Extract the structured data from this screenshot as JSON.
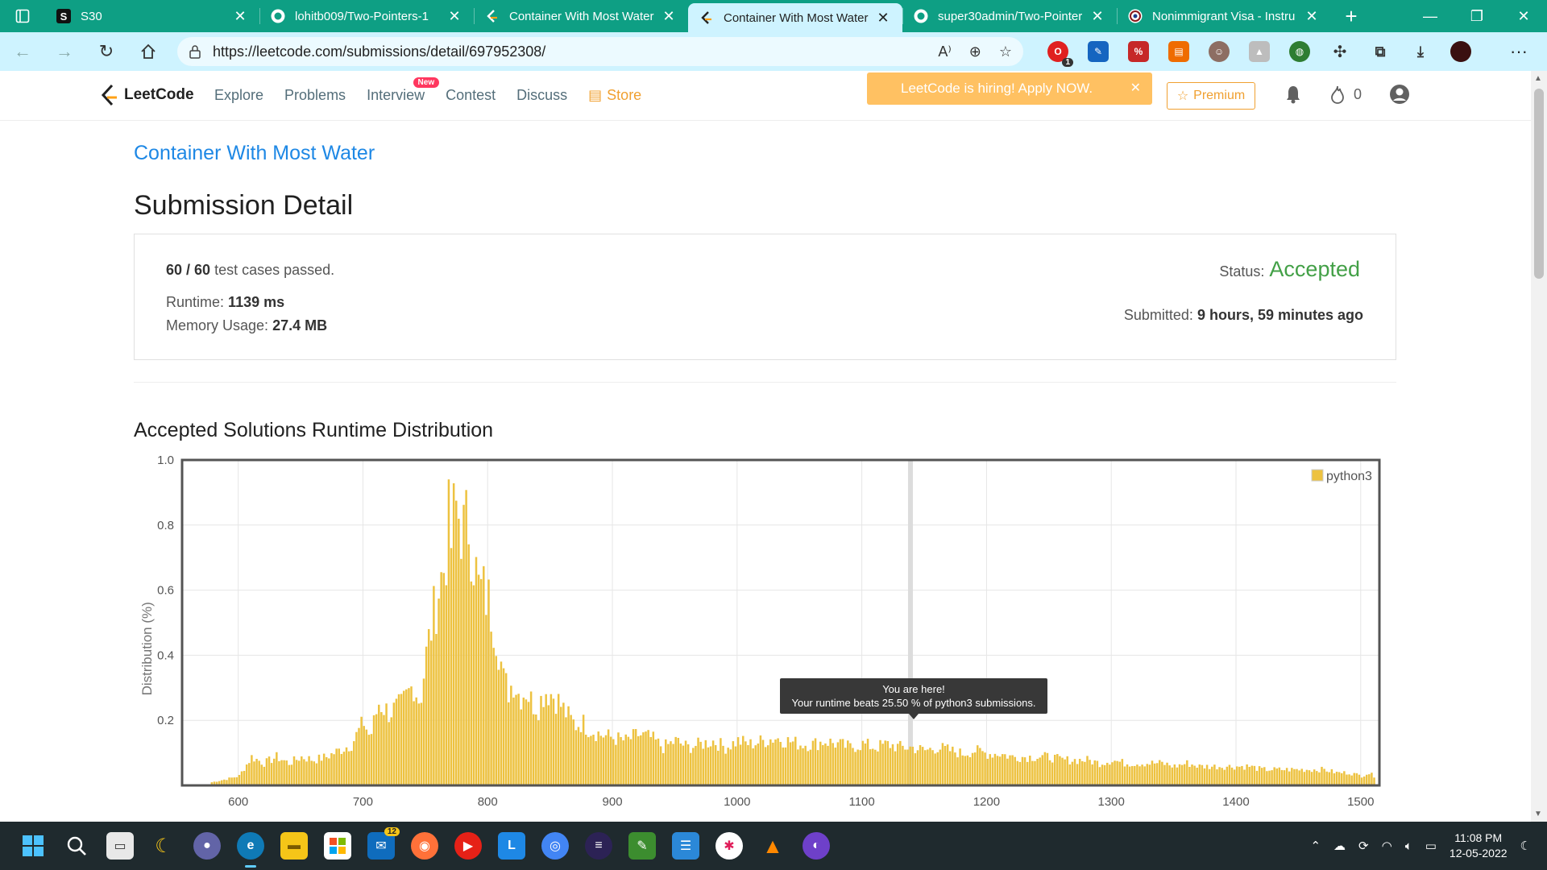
{
  "browser": {
    "tabs": [
      {
        "title": "S30",
        "favicon": "s30-logo-icon",
        "active": false
      },
      {
        "title": "lohitb009/Two-Pointers-1",
        "favicon": "github-icon",
        "active": false
      },
      {
        "title": "Container With Most Water",
        "favicon": "leetcode-icon",
        "active": false
      },
      {
        "title": "Container With Most Water",
        "favicon": "leetcode-icon",
        "active": true
      },
      {
        "title": "super30admin/Two-Pointer",
        "favicon": "github-icon",
        "active": false
      },
      {
        "title": "Nonimmigrant Visa - Instru",
        "favicon": "seal-icon",
        "active": false
      }
    ],
    "url": "https://leetcode.com/submissions/detail/697952308/",
    "extension_badge": "1"
  },
  "site": {
    "brand": "LeetCode",
    "nav": [
      "Explore",
      "Problems",
      "Interview",
      "Contest",
      "Discuss"
    ],
    "new_badge": "New",
    "store": "Store",
    "hiring_banner": "LeetCode is hiring! Apply NOW.",
    "premium": "Premium",
    "coins": "0"
  },
  "submission": {
    "problem_title": "Container With Most Water",
    "page_title": "Submission Detail",
    "tests_passed": "60 / 60",
    "tests_suffix": "test cases passed.",
    "runtime_label": "Runtime:",
    "runtime_value": "1139 ms",
    "memory_label": "Memory Usage:",
    "memory_value": "27.4 MB",
    "status_label": "Status:",
    "status_value": "Accepted",
    "submitted_label": "Submitted:",
    "submitted_value": "9 hours, 59 minutes ago",
    "status_color": "#43a047"
  },
  "distribution": {
    "section_title": "Accepted Solutions Runtime Distribution",
    "tooltip_line1": "You are here!",
    "tooltip_line2": "Your runtime beats 25.50 % of python3 submissions."
  },
  "chart_data": {
    "type": "bar",
    "title": "",
    "xlabel": "",
    "ylabel": "Distribution (%)",
    "xlim": [
      555,
      1515
    ],
    "ylim": [
      0,
      1.0
    ],
    "x_ticks": [
      600,
      700,
      800,
      900,
      1000,
      1100,
      1200,
      1300,
      1400,
      1500
    ],
    "y_ticks": [
      0.2,
      0.4,
      0.6,
      0.8,
      1.0
    ],
    "grid": true,
    "legend": "top-right",
    "bar_color": "#edc240",
    "highlight_x": 1139,
    "series": [
      {
        "name": "python3",
        "points": [
          [
            578,
            0.01
          ],
          [
            590,
            0.02
          ],
          [
            600,
            0.03
          ],
          [
            605,
            0.06
          ],
          [
            610,
            0.09
          ],
          [
            620,
            0.07
          ],
          [
            630,
            0.09
          ],
          [
            640,
            0.07
          ],
          [
            650,
            0.09
          ],
          [
            660,
            0.08
          ],
          [
            670,
            0.09
          ],
          [
            680,
            0.11
          ],
          [
            690,
            0.13
          ],
          [
            700,
            0.2
          ],
          [
            705,
            0.15
          ],
          [
            712,
            0.26
          ],
          [
            720,
            0.23
          ],
          [
            730,
            0.25
          ],
          [
            740,
            0.32
          ],
          [
            745,
            0.26
          ],
          [
            750,
            0.41
          ],
          [
            755,
            0.52
          ],
          [
            760,
            0.62
          ],
          [
            765,
            0.7
          ],
          [
            768,
            0.82
          ],
          [
            770,
            0.76
          ],
          [
            773,
            0.88
          ],
          [
            776,
            0.85
          ],
          [
            780,
            0.8
          ],
          [
            784,
            0.83
          ],
          [
            788,
            0.72
          ],
          [
            792,
            0.62
          ],
          [
            796,
            0.61
          ],
          [
            800,
            0.58
          ],
          [
            804,
            0.52
          ],
          [
            808,
            0.44
          ],
          [
            812,
            0.33
          ],
          [
            816,
            0.3
          ],
          [
            820,
            0.33
          ],
          [
            825,
            0.28
          ],
          [
            830,
            0.3
          ],
          [
            835,
            0.26
          ],
          [
            840,
            0.25
          ],
          [
            845,
            0.3
          ],
          [
            850,
            0.29
          ],
          [
            855,
            0.27
          ],
          [
            860,
            0.24
          ],
          [
            865,
            0.21
          ],
          [
            870,
            0.19
          ],
          [
            875,
            0.2
          ],
          [
            880,
            0.18
          ],
          [
            890,
            0.16
          ],
          [
            900,
            0.15
          ],
          [
            910,
            0.14
          ],
          [
            920,
            0.16
          ],
          [
            930,
            0.15
          ],
          [
            940,
            0.12
          ],
          [
            950,
            0.14
          ],
          [
            960,
            0.12
          ],
          [
            970,
            0.13
          ],
          [
            980,
            0.14
          ],
          [
            990,
            0.12
          ],
          [
            1000,
            0.14
          ],
          [
            1010,
            0.13
          ],
          [
            1020,
            0.14
          ],
          [
            1030,
            0.15
          ],
          [
            1040,
            0.14
          ],
          [
            1050,
            0.13
          ],
          [
            1060,
            0.13
          ],
          [
            1070,
            0.14
          ],
          [
            1080,
            0.13
          ],
          [
            1090,
            0.12
          ],
          [
            1100,
            0.13
          ],
          [
            1110,
            0.12
          ],
          [
            1120,
            0.13
          ],
          [
            1130,
            0.12
          ],
          [
            1139,
            0.12
          ],
          [
            1150,
            0.11
          ],
          [
            1160,
            0.12
          ],
          [
            1170,
            0.11
          ],
          [
            1180,
            0.1
          ],
          [
            1190,
            0.11
          ],
          [
            1200,
            0.1
          ],
          [
            1210,
            0.1
          ],
          [
            1220,
            0.09
          ],
          [
            1230,
            0.09
          ],
          [
            1240,
            0.09
          ],
          [
            1250,
            0.09
          ],
          [
            1260,
            0.08
          ],
          [
            1270,
            0.08
          ],
          [
            1280,
            0.08
          ],
          [
            1290,
            0.07
          ],
          [
            1300,
            0.08
          ],
          [
            1310,
            0.07
          ],
          [
            1320,
            0.07
          ],
          [
            1330,
            0.07
          ],
          [
            1340,
            0.07
          ],
          [
            1350,
            0.06
          ],
          [
            1360,
            0.07
          ],
          [
            1370,
            0.06
          ],
          [
            1380,
            0.06
          ],
          [
            1390,
            0.06
          ],
          [
            1400,
            0.06
          ],
          [
            1410,
            0.06
          ],
          [
            1420,
            0.05
          ],
          [
            1430,
            0.05
          ],
          [
            1440,
            0.05
          ],
          [
            1450,
            0.05
          ],
          [
            1460,
            0.05
          ],
          [
            1470,
            0.05
          ],
          [
            1480,
            0.04
          ],
          [
            1490,
            0.04
          ],
          [
            1500,
            0.03
          ],
          [
            1505,
            0.04
          ],
          [
            1510,
            0.03
          ]
        ]
      }
    ]
  },
  "taskbar": {
    "mail_badge": "12",
    "time": "11:08 PM",
    "date": "12-05-2022"
  }
}
